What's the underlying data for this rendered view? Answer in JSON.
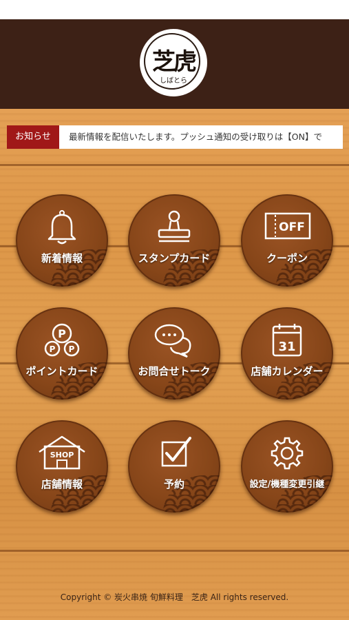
{
  "logo": {
    "main": "芝虎",
    "sub": "しばとら"
  },
  "news": {
    "tag": "お知らせ",
    "text": "最新情報を配信いたします。プッシュ通知の受け取りは【ON】で"
  },
  "menu": [
    {
      "label": "新着情報",
      "icon": "bell-icon"
    },
    {
      "label": "スタンプカード",
      "icon": "stamp-icon"
    },
    {
      "label": "クーポン",
      "icon": "coupon-icon",
      "icon_text": "OFF"
    },
    {
      "label": "ポイントカード",
      "icon": "points-icon",
      "icon_text": "P"
    },
    {
      "label": "お問合せトーク",
      "icon": "chat-icon"
    },
    {
      "label": "店舗カレンダー",
      "icon": "calendar-icon",
      "icon_text": "31"
    },
    {
      "label": "店舗情報",
      "icon": "shop-icon",
      "icon_text": "SHOP"
    },
    {
      "label": "予約",
      "icon": "checkbox-icon"
    },
    {
      "label": "設定/機種変更引継",
      "icon": "gear-icon"
    }
  ],
  "footer": {
    "copyright": "Copyright © 炭火串焼 旬鮮料理　芝虎 All rights reserved."
  },
  "colors": {
    "header": "#3d2116",
    "tag": "#a01818",
    "button": "#874619",
    "wood": "#e09c50"
  }
}
